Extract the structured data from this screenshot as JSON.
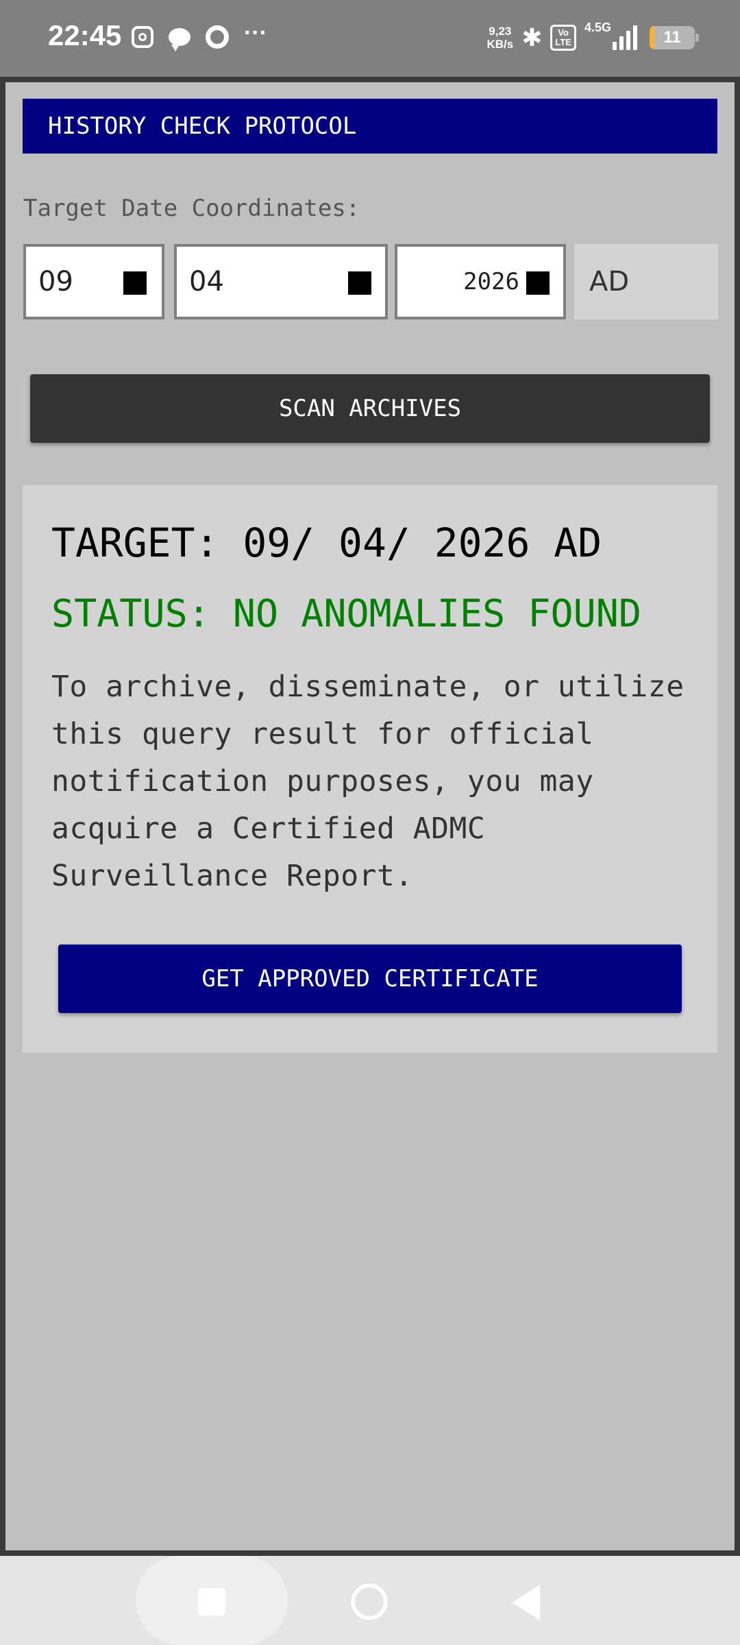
{
  "status_bar": {
    "time": "22:45",
    "notification_icons": [
      "instagram-icon",
      "chat-bubble-icon",
      "ring-icon",
      "more-dots-icon"
    ],
    "more_dots": "···",
    "speed_value": "9,23",
    "speed_unit": "KB/s",
    "bluetooth_glyph": "✱",
    "volte_top": "Vo",
    "volte_bottom": "LTE",
    "network": "4.5G",
    "battery_level": "11",
    "battery_fraction": 0.11,
    "battery_color": "#f1b33a"
  },
  "header": {
    "title": "HISTORY CHECK PROTOCOL",
    "bg_color": "#000080"
  },
  "form": {
    "label": "Target Date Coordinates:",
    "day": "09",
    "month": "04",
    "year": "2026",
    "era": "AD"
  },
  "scan_button": {
    "label": "SCAN ARCHIVES"
  },
  "result": {
    "target": "TARGET: 09/ 04/ 2026 AD",
    "status": "STATUS: NO ANOMALIES FOUND",
    "status_color": "#008000",
    "description": "To archive, disseminate, or utilize this query result for official notification purposes, you may acquire a Certified ADMC Surveillance Report.",
    "certificate_button": "GET APPROVED CERTIFICATE"
  },
  "nav_bar": {
    "buttons": [
      "recents-square-icon",
      "home-circle-icon",
      "back-triangle-icon"
    ]
  }
}
